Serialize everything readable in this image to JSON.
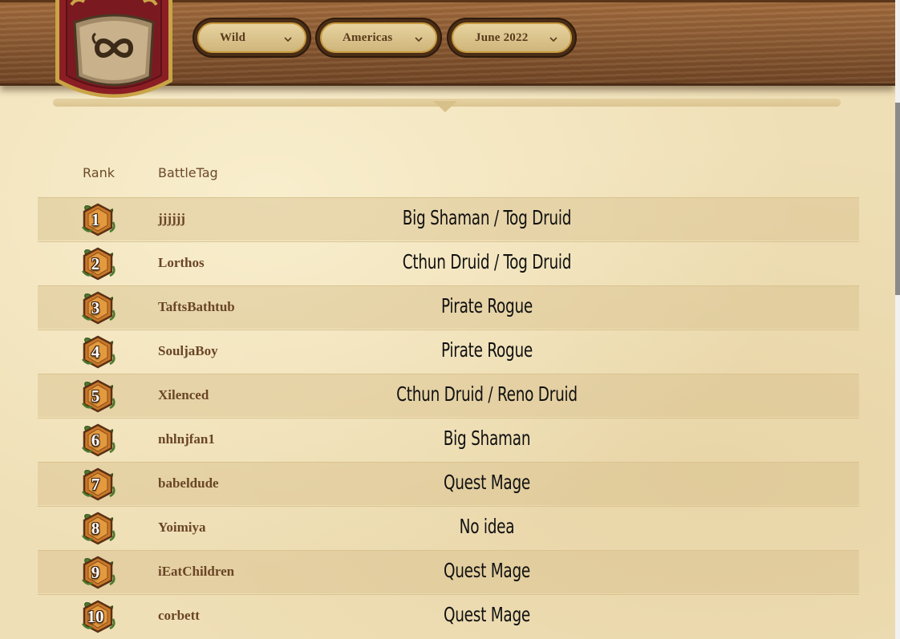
{
  "filters": {
    "mode": {
      "label": "Wild"
    },
    "region": {
      "label": "Americas"
    },
    "season": {
      "label": "June 2022"
    }
  },
  "table": {
    "headers": {
      "rank": "Rank",
      "battletag": "BattleTag"
    },
    "rows": [
      {
        "rank": "1",
        "battletag": "jjjjjj",
        "deck": "Big Shaman / Tog Druid"
      },
      {
        "rank": "2",
        "battletag": "Lorthos",
        "deck": "Cthun Druid / Tog Druid"
      },
      {
        "rank": "3",
        "battletag": "TaftsBathtub",
        "deck": "Pirate Rogue"
      },
      {
        "rank": "4",
        "battletag": "SouljaBoy",
        "deck": "Pirate Rogue"
      },
      {
        "rank": "5",
        "battletag": "Xilenced",
        "deck": "Cthun Druid / Reno Druid"
      },
      {
        "rank": "6",
        "battletag": "nhlnjfan1",
        "deck": "Big Shaman"
      },
      {
        "rank": "7",
        "battletag": "babeldude",
        "deck": "Quest Mage"
      },
      {
        "rank": "8",
        "battletag": "Yoimiya",
        "deck": "No idea"
      },
      {
        "rank": "9",
        "battletag": "iEatChildren",
        "deck": "Quest Mage"
      },
      {
        "rank": "10",
        "battletag": "corbett",
        "deck": "Quest Mage"
      }
    ]
  },
  "colors": {
    "parchment": "#efdfb6",
    "wood": "#8a5a33",
    "crest_red": "#8b1e24",
    "text_brown": "#6a4526"
  },
  "icons": {
    "crest": "hearthstone-crest-icon",
    "rank_badge": "rank-badge-icon",
    "dropdown": "chevron-down-icon"
  }
}
